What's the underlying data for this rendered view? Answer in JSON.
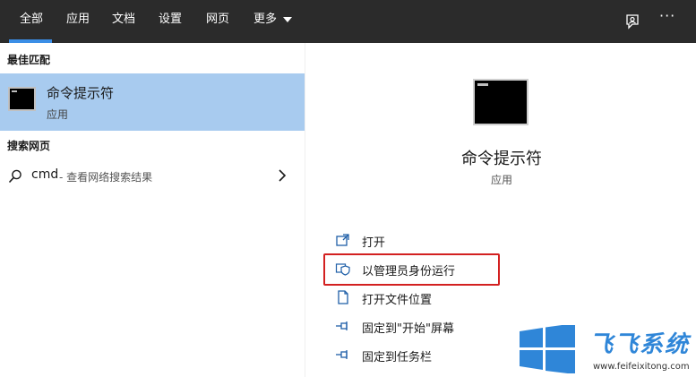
{
  "topbar": {
    "tabs": [
      {
        "label": "全部",
        "active": true
      },
      {
        "label": "应用"
      },
      {
        "label": "文档"
      },
      {
        "label": "设置"
      },
      {
        "label": "网页"
      },
      {
        "label": "更多"
      }
    ],
    "feedback_icon": "feedback-icon",
    "more_icon": "ellipsis-icon",
    "more_text": "···",
    "accent_color": "#3b8ee6",
    "bg_color": "#2b2b2b"
  },
  "left": {
    "best_match_heading": "最佳匹配",
    "best_match": {
      "title": "命令提示符",
      "subtitle": "应用",
      "icon": "cmd-icon",
      "highlight_color": "#a8cbef"
    },
    "web_heading": "搜索网页",
    "web_result": {
      "query": "cmd",
      "hint": " - 查看网络搜索结果",
      "icon": "search-icon",
      "arrow": "chevron-right-icon"
    }
  },
  "right": {
    "title": "命令提示符",
    "subtitle": "应用",
    "icon": "cmd-icon",
    "actions": [
      {
        "label": "打开",
        "icon": "open-icon"
      },
      {
        "label": "以管理员身份运行",
        "icon": "shield-admin-icon",
        "highlighted": true
      },
      {
        "label": "打开文件位置",
        "icon": "file-location-icon"
      },
      {
        "label": "固定到\"开始\"屏幕",
        "icon": "pin-icon"
      },
      {
        "label": "固定到任务栏",
        "icon": "pin-icon"
      }
    ],
    "highlight_border_color": "#d32020"
  },
  "watermark": {
    "brand": "飞飞系统",
    "url": "www.feifeixitong.com",
    "logo": "windows-logo-icon",
    "brand_color": "#2f86d8"
  }
}
